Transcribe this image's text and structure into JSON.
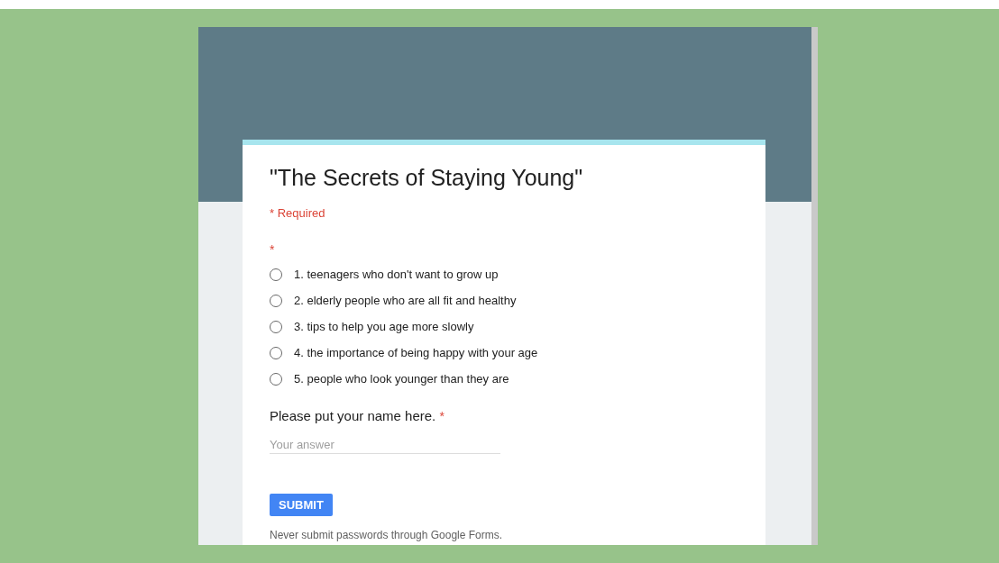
{
  "form": {
    "title": "\"The Secrets of Staying Young\"",
    "required_note": "* Required"
  },
  "questions": [
    {
      "kind": "choice",
      "required_mark": "*",
      "options": [
        {
          "label": "1. teenagers who don't want to grow up",
          "selected": false
        },
        {
          "label": "2. elderly people who are all fit and healthy",
          "selected": false
        },
        {
          "label": "3. tips to help you age more slowly",
          "selected": false
        },
        {
          "label": "4. the importance of being happy with your age",
          "selected": false
        },
        {
          "label": "5. people who look younger than they are",
          "selected": false
        }
      ]
    },
    {
      "kind": "text",
      "label": "Please put your name here.",
      "required_mark": "*",
      "placeholder": "Your answer"
    }
  ],
  "submit": "SUBMIT",
  "footer": "Never submit passwords through Google Forms."
}
